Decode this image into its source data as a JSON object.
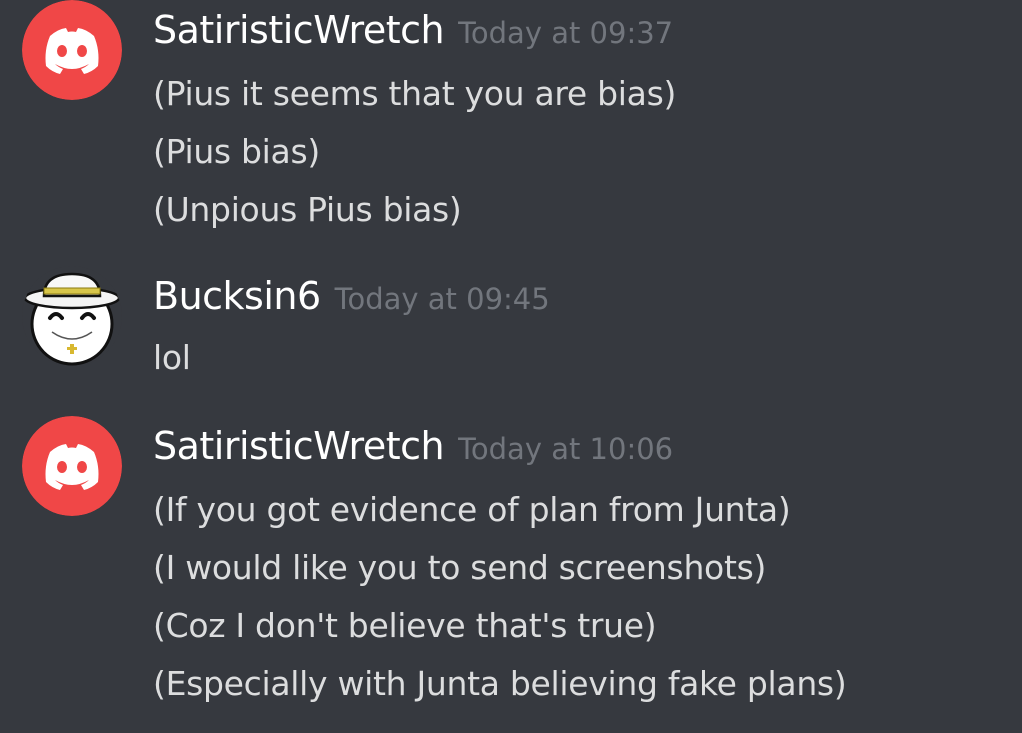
{
  "messages": [
    {
      "author": "SatiristicWretch",
      "avatar_icon": "discord-logo-icon",
      "avatar_color": "#f04747",
      "timestamp": "Today at 09:37",
      "lines": [
        "(Pius it seems that you are bias)",
        "(Pius bias)",
        "(Unpious Pius bias)"
      ]
    },
    {
      "author": "Bucksin6",
      "avatar_icon": "countryball-pope-hat-icon",
      "avatar_color": "#ffffff",
      "timestamp": "Today at 09:45",
      "lines": [
        "lol"
      ]
    },
    {
      "author": "SatiristicWretch",
      "avatar_icon": "discord-logo-icon",
      "avatar_color": "#f04747",
      "timestamp": "Today at 10:06",
      "lines": [
        "(If you got evidence of plan from Junta)",
        "(I would like you to send screenshots)",
        "(Coz I don't believe that's true)",
        "(Especially with Junta believing fake plans)"
      ]
    }
  ],
  "theme": {
    "background": "#36393f",
    "username_color": "#ffffff",
    "timestamp_color": "#72767d",
    "text_color": "#dcddde"
  }
}
